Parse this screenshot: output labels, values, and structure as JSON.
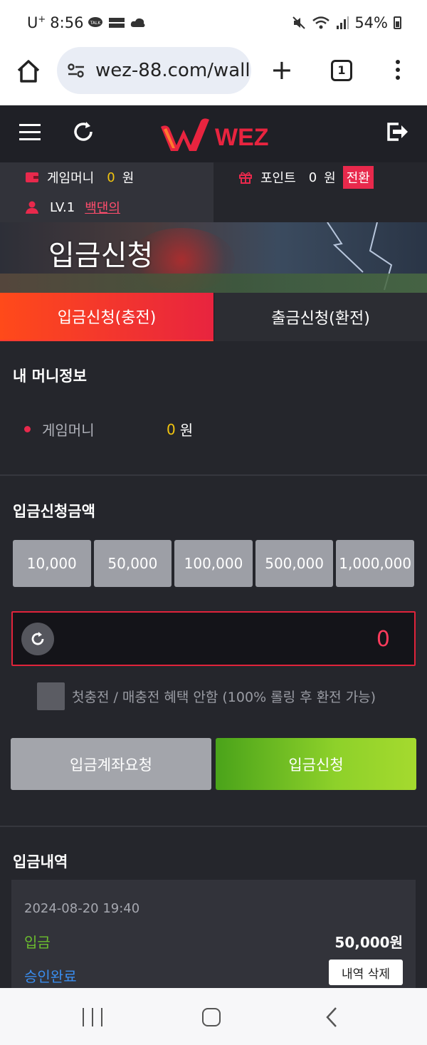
{
  "status_bar": {
    "carrier": "U",
    "carrier_sup": "+",
    "time": "8:56",
    "battery": "54%",
    "icons": [
      "talk-icon",
      "livescore-icon",
      "cloud-icon",
      "mute-icon",
      "wifi-icon",
      "signal-icon",
      "battery-icon"
    ]
  },
  "browser": {
    "url": "wez-88.com/wall",
    "tab_count": "1"
  },
  "header": {
    "logo_text": "WEZ",
    "colors": {
      "logo_red": "#e8243f",
      "header_bg": "#1f2026"
    }
  },
  "info": {
    "game_money_label": "게임머니",
    "game_money_value": "0",
    "game_money_unit": "원",
    "point_label": "포인트",
    "point_value": "0",
    "point_unit": "원",
    "convert_label": "전환",
    "level": "LV.1",
    "nickname": "백댄의"
  },
  "banner": {
    "title": "입금신청"
  },
  "tabs": [
    {
      "label": "입금신청(충전)",
      "active": true
    },
    {
      "label": "출금신청(환전)",
      "active": false
    }
  ],
  "money_info": {
    "title": "내 머니정보",
    "label": "게임머니",
    "value": "0",
    "unit": "원"
  },
  "deposit": {
    "title": "입금신청금액",
    "amounts": [
      "10,000",
      "50,000",
      "100,000",
      "500,000",
      "1,000,000"
    ],
    "input_value": "0",
    "checkbox_label": "첫충전 / 매충전 혜택 안함 (100% 롤링 후 환전 가능)",
    "account_button": "입금계좌요청",
    "submit_button": "입금신청",
    "colors": {
      "accent": "#e0233b",
      "submit_green": "#8ed12a"
    }
  },
  "history": {
    "title": "입금내역",
    "items": [
      {
        "date": "2024-08-20 19:40",
        "type": "입금",
        "amount": "50,000원",
        "status": "승인완료",
        "delete_label": "내역 삭제"
      }
    ]
  }
}
